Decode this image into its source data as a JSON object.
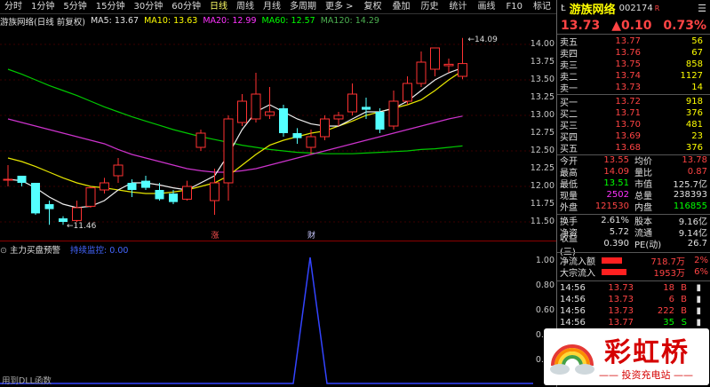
{
  "toolbar": {
    "items": [
      "分时",
      "1分钟",
      "5分钟",
      "15分钟",
      "30分钟",
      "60分钟",
      "日线",
      "周线",
      "月线",
      "多周期",
      "更多 >"
    ],
    "active": "日线",
    "right_items": [
      "复权",
      "叠加",
      "历史",
      "统计",
      "画线",
      "F10",
      "标记",
      "-"
    ]
  },
  "ma_bar": {
    "title": "游族网络(日线 前复权)",
    "ma5": "MA5: 13.67",
    "ma10": "MA10: 13.63",
    "ma20": "MA20: 12.99",
    "ma60": "MA60: 12.57",
    "ma120": "MA120: 14.29",
    "colors": {
      "ma5": "#ffffff",
      "ma10": "#ffff00",
      "ma20": "#ff33ff",
      "ma60": "#00ff00",
      "ma120": "#4caf50"
    }
  },
  "chart_labels": {
    "high_label": "14.09",
    "low_label": "11.46",
    "marker_zhang": "涨",
    "marker_cai": "财"
  },
  "price_scale": [
    "14.00",
    "13.75",
    "13.50",
    "13.25",
    "13.00",
    "12.75",
    "12.50",
    "12.25",
    "12.00",
    "11.75",
    "11.50"
  ],
  "sub_panel": {
    "title": "主力买盘预警",
    "legend": "持续监控: 0.00",
    "scale": [
      "1.00",
      "0.80",
      "0.60",
      "0.40",
      "0.20"
    ],
    "bottom_text": "用到DLL函数"
  },
  "stock": {
    "code_prefix": "L",
    "name": "游族网络",
    "code": "002174",
    "badge": "R",
    "price": "13.73",
    "change": "▲0.10",
    "pct": "0.73%"
  },
  "order_book": {
    "sells": [
      {
        "label": "卖五",
        "price": "13.77",
        "vol": "56"
      },
      {
        "label": "卖四",
        "price": "13.76",
        "vol": "67"
      },
      {
        "label": "卖三",
        "price": "13.75",
        "vol": "858"
      },
      {
        "label": "卖二",
        "price": "13.74",
        "vol": "1127"
      },
      {
        "label": "卖一",
        "price": "13.73",
        "vol": "14"
      }
    ],
    "buys": [
      {
        "label": "买一",
        "price": "13.72",
        "vol": "918"
      },
      {
        "label": "买二",
        "price": "13.71",
        "vol": "376"
      },
      {
        "label": "买三",
        "price": "13.70",
        "vol": "481"
      },
      {
        "label": "买四",
        "price": "13.69",
        "vol": "23"
      },
      {
        "label": "买五",
        "price": "13.68",
        "vol": "376"
      }
    ]
  },
  "stats": [
    {
      "k": "今开",
      "v": "13.55",
      "vc": "red",
      "k2": "均价",
      "v2": "13.78",
      "v2c": "red"
    },
    {
      "k": "最高",
      "v": "14.09",
      "vc": "red",
      "k2": "量比",
      "v2": "0.87",
      "v2c": "red"
    },
    {
      "k": "最低",
      "v": "13.51",
      "vc": "green",
      "k2": "市值",
      "v2": "125.7亿",
      "v2c": "white"
    },
    {
      "k": "现量",
      "v": "2502",
      "vc": "magenta",
      "k2": "总量",
      "v2": "238393",
      "v2c": "white"
    },
    {
      "k": "外盘",
      "v": "121530",
      "vc": "red",
      "k2": "内盘",
      "v2": "116855",
      "v2c": "green"
    }
  ],
  "stats2": [
    {
      "k": "换手",
      "v": "2.61%",
      "vc": "white",
      "k2": "股本",
      "v2": "9.16亿",
      "v2c": "white"
    },
    {
      "k": "净资",
      "v": "5.72",
      "vc": "white",
      "k2": "流通",
      "v2": "9.14亿",
      "v2c": "white"
    },
    {
      "k": "收益(三)",
      "v": "0.390",
      "vc": "white",
      "k2": "PE(动)",
      "v2": "26.7",
      "v2c": "white"
    }
  ],
  "flows": [
    {
      "label": "净流入额",
      "value": "718.7万",
      "pct": "2%",
      "fill": 0.45
    },
    {
      "label": "大宗流入",
      "value": "1953万",
      "pct": "6%",
      "fill": 0.55
    }
  ],
  "ticks": [
    {
      "time": "14:56",
      "price": "13.73",
      "vol": "18",
      "dir": "B"
    },
    {
      "time": "14:56",
      "price": "13.73",
      "vol": "6",
      "dir": "B"
    },
    {
      "time": "14:56",
      "price": "13.73",
      "vol": "222",
      "dir": "B"
    },
    {
      "time": "14:56",
      "price": "13.77",
      "vol": "35",
      "dir": "S"
    }
  ],
  "logo": {
    "name": "彩虹桥",
    "tagline": "—— 投资充电站 ——"
  },
  "chart_data": {
    "type": "candlestick",
    "yrange": [
      11.4,
      14.15
    ],
    "candles": [
      {
        "o": 12.1,
        "c": 12.1,
        "h": 12.3,
        "l": 12.0
      },
      {
        "o": 12.15,
        "c": 12.05,
        "h": 12.15,
        "l": 12.0
      },
      {
        "o": 12.05,
        "c": 11.62,
        "h": 12.05,
        "l": 11.6
      },
      {
        "o": 11.75,
        "c": 11.68,
        "h": 11.8,
        "l": 11.46
      },
      {
        "o": 11.55,
        "c": 11.5,
        "h": 11.58,
        "l": 11.46
      },
      {
        "o": 11.52,
        "c": 11.7,
        "h": 11.8,
        "l": 11.5
      },
      {
        "o": 11.72,
        "c": 11.98,
        "h": 12.0,
        "l": 11.7
      },
      {
        "o": 11.95,
        "c": 12.05,
        "h": 12.12,
        "l": 11.9
      },
      {
        "o": 12.15,
        "c": 12.3,
        "h": 12.4,
        "l": 12.05
      },
      {
        "o": 12.05,
        "c": 11.95,
        "h": 12.1,
        "l": 11.85
      },
      {
        "o": 12.08,
        "c": 11.98,
        "h": 12.15,
        "l": 11.95
      },
      {
        "o": 11.95,
        "c": 11.82,
        "h": 12.05,
        "l": 11.8
      },
      {
        "o": 11.9,
        "c": 11.78,
        "h": 11.95,
        "l": 11.75
      },
      {
        "o": 11.82,
        "c": 12.0,
        "h": 12.08,
        "l": 11.8
      },
      {
        "o": 12.55,
        "c": 12.75,
        "h": 12.8,
        "l": 12.5
      },
      {
        "o": 11.8,
        "c": 12.05,
        "h": 12.25,
        "l": 11.6
      },
      {
        "o": 12.05,
        "c": 12.95,
        "h": 13.0,
        "l": 11.8
      },
      {
        "o": 12.9,
        "c": 13.2,
        "h": 13.3,
        "l": 12.85
      },
      {
        "o": 12.95,
        "c": 13.3,
        "h": 13.6,
        "l": 12.9
      },
      {
        "o": 13.0,
        "c": 13.05,
        "h": 13.4,
        "l": 12.95
      },
      {
        "o": 13.1,
        "c": 12.75,
        "h": 13.15,
        "l": 12.7
      },
      {
        "o": 12.75,
        "c": 12.68,
        "h": 12.82,
        "l": 12.6
      },
      {
        "o": 12.55,
        "c": 12.7,
        "h": 12.8,
        "l": 12.45
      },
      {
        "o": 12.7,
        "c": 12.95,
        "h": 13.0,
        "l": 12.65
      },
      {
        "o": 12.95,
        "c": 13.0,
        "h": 13.05,
        "l": 12.85
      },
      {
        "o": 13.05,
        "c": 13.3,
        "h": 13.45,
        "l": 13.0
      },
      {
        "o": 13.12,
        "c": 13.08,
        "h": 13.25,
        "l": 12.95
      },
      {
        "o": 13.05,
        "c": 12.8,
        "h": 13.1,
        "l": 12.75
      },
      {
        "o": 12.85,
        "c": 13.2,
        "h": 13.35,
        "l": 12.8
      },
      {
        "o": 13.2,
        "c": 13.45,
        "h": 13.55,
        "l": 13.15
      },
      {
        "o": 13.45,
        "c": 13.75,
        "h": 13.9,
        "l": 13.4
      },
      {
        "o": 13.65,
        "c": 13.95,
        "h": 13.95,
        "l": 13.55
      },
      {
        "o": 13.7,
        "c": 13.72,
        "h": 13.8,
        "l": 13.6
      },
      {
        "o": 13.55,
        "c": 13.73,
        "h": 14.09,
        "l": 13.51
      }
    ],
    "ma5": [
      12.1,
      12.08,
      11.98,
      11.85,
      11.75,
      11.7,
      11.72,
      11.8,
      11.95,
      12.05,
      12.05,
      12.02,
      11.98,
      11.95,
      12.05,
      12.15,
      12.45,
      12.8,
      13.05,
      13.15,
      13.05,
      12.95,
      12.88,
      12.85,
      12.85,
      12.95,
      13.05,
      13.05,
      13.1,
      13.2,
      13.35,
      13.5,
      13.6,
      13.67
    ],
    "ma10": [
      12.4,
      12.35,
      12.28,
      12.2,
      12.12,
      12.05,
      12.0,
      11.98,
      11.95,
      11.92,
      11.9,
      11.9,
      11.92,
      11.95,
      12.0,
      12.05,
      12.15,
      12.3,
      12.45,
      12.58,
      12.65,
      12.7,
      12.75,
      12.78,
      12.85,
      12.92,
      13.0,
      13.05,
      13.1,
      13.15,
      13.22,
      13.35,
      13.5,
      13.63
    ],
    "ma20": [
      12.95,
      12.9,
      12.85,
      12.8,
      12.75,
      12.7,
      12.65,
      12.6,
      12.52,
      12.45,
      12.4,
      12.35,
      12.3,
      12.25,
      12.22,
      12.2,
      12.2,
      12.22,
      12.25,
      12.3,
      12.35,
      12.4,
      12.45,
      12.5,
      12.55,
      12.6,
      12.65,
      12.7,
      12.75,
      12.8,
      12.85,
      12.9,
      12.95,
      12.99
    ],
    "ma60": [
      13.65,
      13.58,
      13.5,
      13.42,
      13.35,
      13.28,
      13.2,
      13.12,
      13.05,
      12.98,
      12.92,
      12.86,
      12.8,
      12.75,
      12.7,
      12.66,
      12.62,
      12.58,
      12.55,
      12.52,
      12.5,
      12.48,
      12.47,
      12.46,
      12.46,
      12.46,
      12.47,
      12.48,
      12.49,
      12.5,
      12.52,
      12.53,
      12.55,
      12.57
    ]
  }
}
